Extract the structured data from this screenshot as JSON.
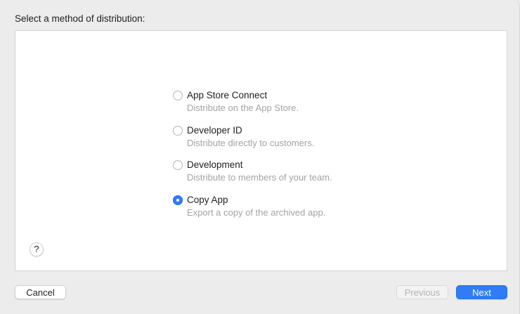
{
  "prompt": "Select a method of distribution:",
  "options": [
    {
      "title": "App Store Connect",
      "description": "Distribute on the App Store.",
      "selected": false
    },
    {
      "title": "Developer ID",
      "description": "Distribute directly to customers.",
      "selected": false
    },
    {
      "title": "Development",
      "description": "Distribute to members of your team.",
      "selected": false
    },
    {
      "title": "Copy App",
      "description": "Export a copy of the archived app.",
      "selected": true
    }
  ],
  "help": {
    "label": "?"
  },
  "buttons": {
    "cancel": "Cancel",
    "previous": "Previous",
    "next": "Next"
  },
  "colors": {
    "accent": "#2f7cf6",
    "disabled_text": "#b3b3b3",
    "description_text": "#a3a3a3"
  }
}
